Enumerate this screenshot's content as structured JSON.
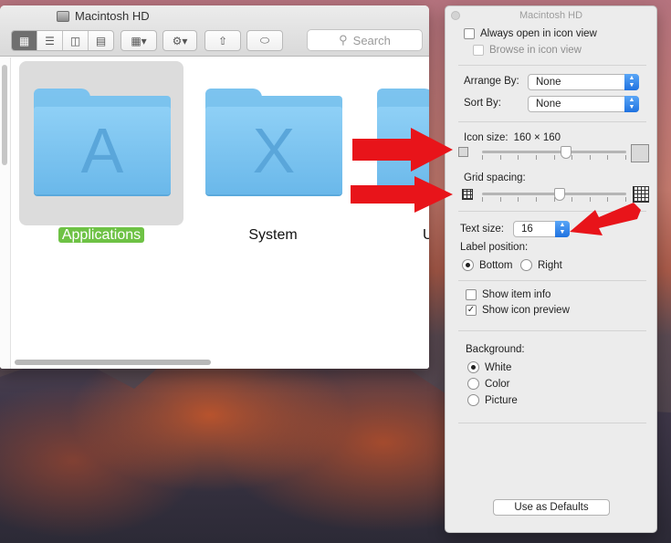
{
  "finder": {
    "title": "Macintosh HD",
    "search_placeholder": "Search",
    "folders": [
      {
        "label": "Applications",
        "glyph": "A",
        "selected": true
      },
      {
        "label": "System",
        "glyph": "X",
        "selected": false
      },
      {
        "label": "U",
        "glyph": "",
        "selected": false
      }
    ]
  },
  "panel": {
    "title": "Macintosh HD",
    "always_open_label": "Always open in icon view",
    "browse_label": "Browse in icon view",
    "arrange_by_label": "Arrange By:",
    "arrange_by_value": "None",
    "sort_by_label": "Sort By:",
    "sort_by_value": "None",
    "icon_size_label": "Icon size:",
    "icon_size_value": "160 × 160",
    "icon_size_fraction": 0.58,
    "grid_spacing_label": "Grid spacing:",
    "grid_spacing_fraction": 0.54,
    "text_size_label": "Text size:",
    "text_size_value": "16",
    "label_position_label": "Label position:",
    "label_bottom": "Bottom",
    "label_right": "Right",
    "show_item_info": "Show item info",
    "show_icon_preview": "Show icon preview",
    "background_label": "Background:",
    "bg_white": "White",
    "bg_color": "Color",
    "bg_picture": "Picture",
    "use_defaults": "Use as Defaults"
  },
  "colors": {
    "arrow": "#e8141a",
    "selection_label": "#6ec245",
    "folder": "#7bc3ee"
  }
}
